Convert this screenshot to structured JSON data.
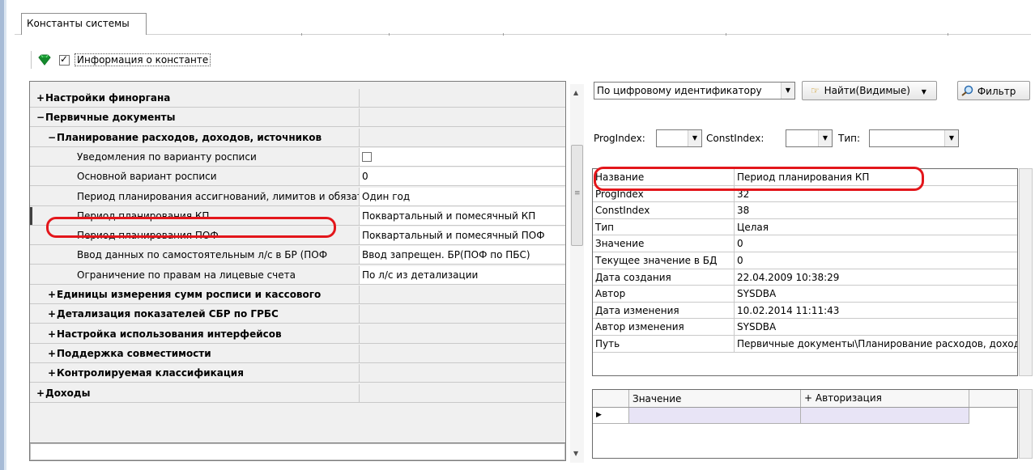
{
  "tab": {
    "label": "Константы системы"
  },
  "toolbar": {
    "info_checked": true,
    "info_label": "Информация о константе"
  },
  "tree": {
    "rows": [
      {
        "type": "cat",
        "level": 0,
        "toggle": "+",
        "name": "Настройки финоргана",
        "value": ""
      },
      {
        "type": "cat",
        "level": 0,
        "toggle": "−",
        "name": "Первичные документы",
        "value": ""
      },
      {
        "type": "cat",
        "level": 1,
        "toggle": "−",
        "name": "Планирование расходов, доходов, источников",
        "value": ""
      },
      {
        "type": "item",
        "level": 2,
        "name": "Уведомления по варианту росписи",
        "value": "",
        "checkbox": true
      },
      {
        "type": "item",
        "level": 2,
        "name": "Основной вариант росписи",
        "value": "0"
      },
      {
        "type": "item",
        "level": 2,
        "name": "Период планирования ассигнований, лимитов и обязательств",
        "value": "Один год"
      },
      {
        "type": "item",
        "level": 2,
        "name": "Период планирования  КП",
        "value": "Поквартальный и помесячный КП",
        "selected": true
      },
      {
        "type": "item",
        "level": 2,
        "name": "Период планирования ПОФ",
        "value": "Поквартальный и помесячный ПОФ"
      },
      {
        "type": "item",
        "level": 2,
        "name": "Ввод данных по самостоятельным л/с в БР (ПОФ",
        "value": "Ввод запрещен. БР(ПОФ по ПБС)"
      },
      {
        "type": "item",
        "level": 2,
        "name": "Ограничение по правам на лицевые счета",
        "value": "По л/с из детализации"
      },
      {
        "type": "cat",
        "level": 1,
        "toggle": "+",
        "name": "Единицы измерения сумм росписи и кассового",
        "value": ""
      },
      {
        "type": "cat",
        "level": 1,
        "toggle": "+",
        "name": "Детализация показателей СБР по ГРБС",
        "value": ""
      },
      {
        "type": "cat",
        "level": 1,
        "toggle": "+",
        "name": "Настройка использования интерфейсов",
        "value": ""
      },
      {
        "type": "cat",
        "level": 1,
        "toggle": "+",
        "name": "Поддержка совместимости",
        "value": ""
      },
      {
        "type": "cat",
        "level": 1,
        "toggle": "+",
        "name": "Контролируемая классификация",
        "value": ""
      },
      {
        "type": "cat",
        "level": 0,
        "toggle": "+",
        "name": "Доходы",
        "value": ""
      }
    ]
  },
  "search": {
    "mode": "По цифровому идентификатору",
    "find_label": "Найти(Видимые)",
    "filter_label": "Фильтр",
    "progindex_label": "ProgIndex:",
    "constindex_label": "ConstIndex:",
    "type_label": "Тип:"
  },
  "info": {
    "rows": [
      {
        "key": "Название",
        "value": "Период планирования  КП"
      },
      {
        "key": "ProgIndex",
        "value": "32"
      },
      {
        "key": "ConstIndex",
        "value": "38"
      },
      {
        "key": "Тип",
        "value": "Целая"
      },
      {
        "key": "Значение",
        "value": "0"
      },
      {
        "key": "Текущее значение в БД",
        "value": "0"
      },
      {
        "key": "Дата создания",
        "value": "22.04.2009 10:38:29"
      },
      {
        "key": "Автор",
        "value": "SYSDBA"
      },
      {
        "key": "Дата изменения",
        "value": "10.02.2014 11:11:43"
      },
      {
        "key": "Автор изменения",
        "value": "SYSDBA"
      },
      {
        "key": "Путь",
        "value": "Первичные документы\\Планирование расходов, доходов"
      }
    ]
  },
  "bottom_grid": {
    "col_value": "Значение",
    "col_auth": "Авторизация",
    "auth_toggle": "+"
  },
  "colors": {
    "highlight": "#e3161b",
    "gem": "#1faa3a",
    "row_selected": "#e8e4f6"
  }
}
